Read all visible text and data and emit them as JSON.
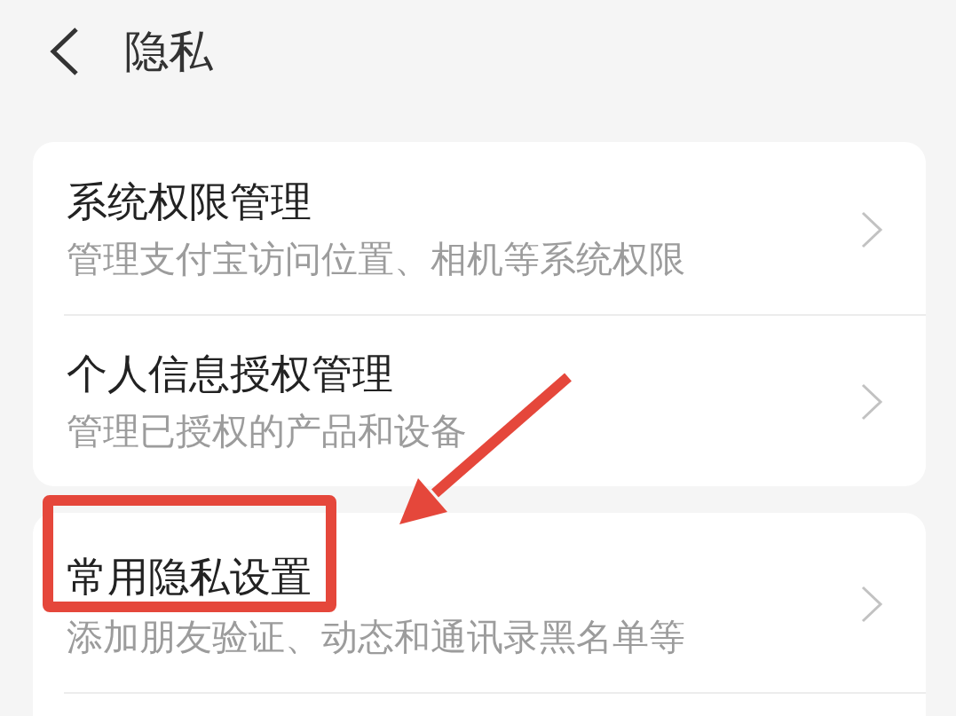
{
  "header": {
    "title": "隐私"
  },
  "sections": [
    {
      "items": [
        {
          "title": "系统权限管理",
          "description": "管理支付宝访问位置、相机等系统权限",
          "highlighted": false
        },
        {
          "title": "个人信息授权管理",
          "description": "管理已授权的产品和设备",
          "highlighted": false
        }
      ]
    },
    {
      "items": [
        {
          "title": "常用隐私设置",
          "description": "添加朋友验证、动态和通讯录黑名单等",
          "highlighted": true
        }
      ]
    }
  ]
}
